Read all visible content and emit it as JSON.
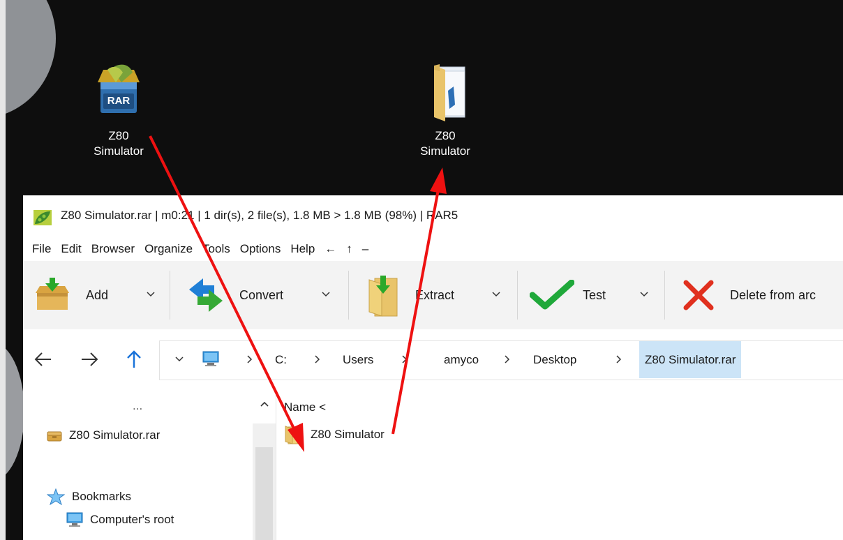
{
  "desktop": {
    "icons": [
      {
        "label_line1": "Z80",
        "label_line2": "Simulator",
        "icon": "rar-archive-icon",
        "badge": "RAR"
      },
      {
        "label_line1": "Z80",
        "label_line2": "Simulator",
        "icon": "folder-icon"
      }
    ]
  },
  "window": {
    "title": "Z80 Simulator.rar | m0:21 | 1 dir(s), 2 file(s), 1.8 MB > 1.8 MB (98%) | RAR5",
    "menu": [
      "File",
      "Edit",
      "Browser",
      "Organize",
      "Tools",
      "Options",
      "Help",
      "←",
      "↑",
      "–"
    ],
    "toolbar": [
      {
        "label": "Add",
        "icon": "add-archive-icon"
      },
      {
        "label": "Convert",
        "icon": "convert-icon"
      },
      {
        "label": "Extract",
        "icon": "extract-icon"
      },
      {
        "label": "Test",
        "icon": "checkmark-icon"
      },
      {
        "label": "Delete from arc",
        "icon": "delete-x-icon"
      }
    ],
    "breadcrumb": [
      "C:",
      "Users",
      "amyco",
      "Desktop",
      "Z80 Simulator.rar"
    ],
    "sidebar": {
      "more": "...",
      "archive_item": "Z80 Simulator.rar",
      "bookmarks": "Bookmarks",
      "computer_root": "Computer's root"
    },
    "filelist": {
      "column_header": "Name <",
      "items": [
        {
          "name": "Z80 Simulator",
          "icon": "folder-icon"
        }
      ]
    }
  },
  "colors": {
    "accent_red_arrow": "#ee1111",
    "selection": "#cce4f7",
    "toolbar_bg": "#f3f3f3"
  }
}
